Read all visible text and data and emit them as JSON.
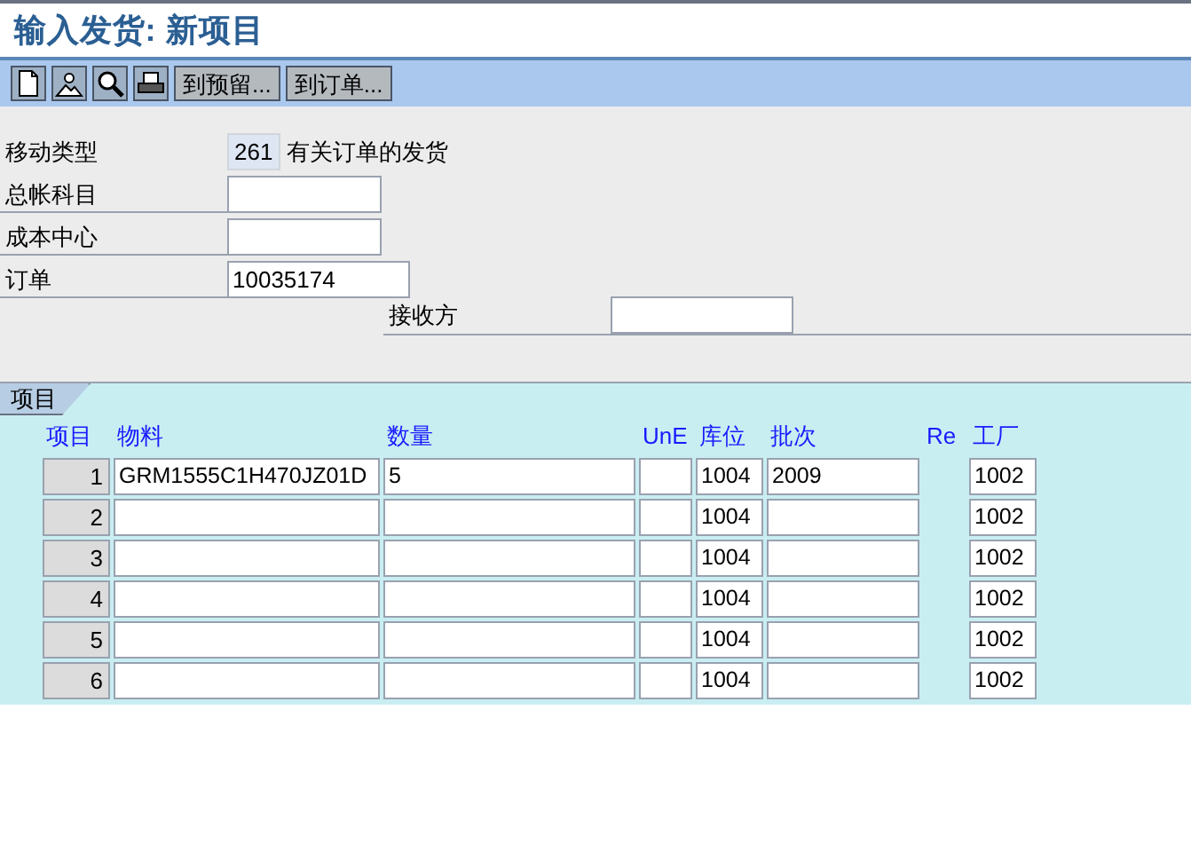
{
  "window": {
    "title": "输入发货: 新项目"
  },
  "toolbar": {
    "buttons": [
      "到预留...",
      "到订单..."
    ]
  },
  "header": {
    "movement_type": {
      "label": "移动类型",
      "value": "261",
      "description": "有关订单的发货"
    },
    "fields": [
      {
        "label": "总帐科目"
      },
      {
        "label": "成本中心"
      },
      {
        "label": "订单",
        "value": "10035174"
      }
    ],
    "receiver": {
      "label": "接收方"
    }
  },
  "items": {
    "tab": "项目",
    "columns": [
      {
        "label": "项目",
        "kind": "number"
      },
      {
        "label": "物料",
        "kind": "input"
      },
      {
        "label": "数量",
        "kind": "input"
      },
      {
        "label": "UnE",
        "kind": "input"
      },
      {
        "label": "库位",
        "kind": "input"
      },
      {
        "label": "批次",
        "kind": "input"
      },
      {
        "label": "Re",
        "kind": "none"
      },
      {
        "label": "工厂",
        "kind": "input"
      }
    ],
    "rows": [
      {
        "cells": [
          {
            "text": "1"
          },
          {
            "text": "GRM1555C1H470JZ01D"
          },
          {
            "text": "5"
          },
          {},
          {
            "text": "1004"
          },
          {
            "text": "2009"
          },
          {
            "text": "1002"
          }
        ]
      },
      {
        "cells": [
          {
            "text": "2"
          },
          {},
          {},
          {},
          {
            "text": "1004"
          },
          {},
          {
            "text": "1002"
          }
        ]
      },
      {
        "cells": [
          {
            "text": "3"
          },
          {},
          {},
          {},
          {
            "text": "1004"
          },
          {},
          {
            "text": "1002"
          }
        ]
      },
      {
        "cells": [
          {
            "text": "4"
          },
          {},
          {},
          {},
          {
            "text": "1004"
          },
          {},
          {
            "text": "1002"
          }
        ]
      },
      {
        "cells": [
          {
            "text": "5"
          },
          {},
          {},
          {},
          {
            "text": "1004"
          },
          {},
          {
            "text": "1002"
          }
        ]
      },
      {
        "cells": [
          {
            "text": "6"
          },
          {},
          {},
          {},
          {
            "text": "1004"
          },
          {},
          {
            "text": "1002"
          }
        ]
      }
    ]
  }
}
